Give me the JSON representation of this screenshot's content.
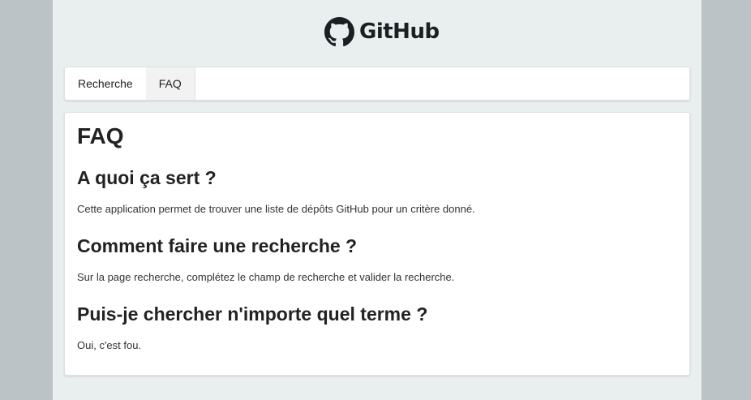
{
  "header": {
    "logo_text": "GitHub",
    "logo_icon": "github-octocat-icon"
  },
  "tabs": [
    {
      "label": "Recherche",
      "active": false
    },
    {
      "label": "FAQ",
      "active": true
    }
  ],
  "faq": {
    "title": "FAQ",
    "items": [
      {
        "question": "A quoi ça sert ?",
        "answer": "Cette application permet de trouver une liste de dépôts GitHub pour un critère donné."
      },
      {
        "question": "Comment faire une recherche ?",
        "answer": "Sur la page recherche, complétez le champ de recherche et valider la recherche."
      },
      {
        "question": "Puis-je chercher n'importe quel terme ?",
        "answer": "Oui, c'est fou."
      }
    ]
  }
}
